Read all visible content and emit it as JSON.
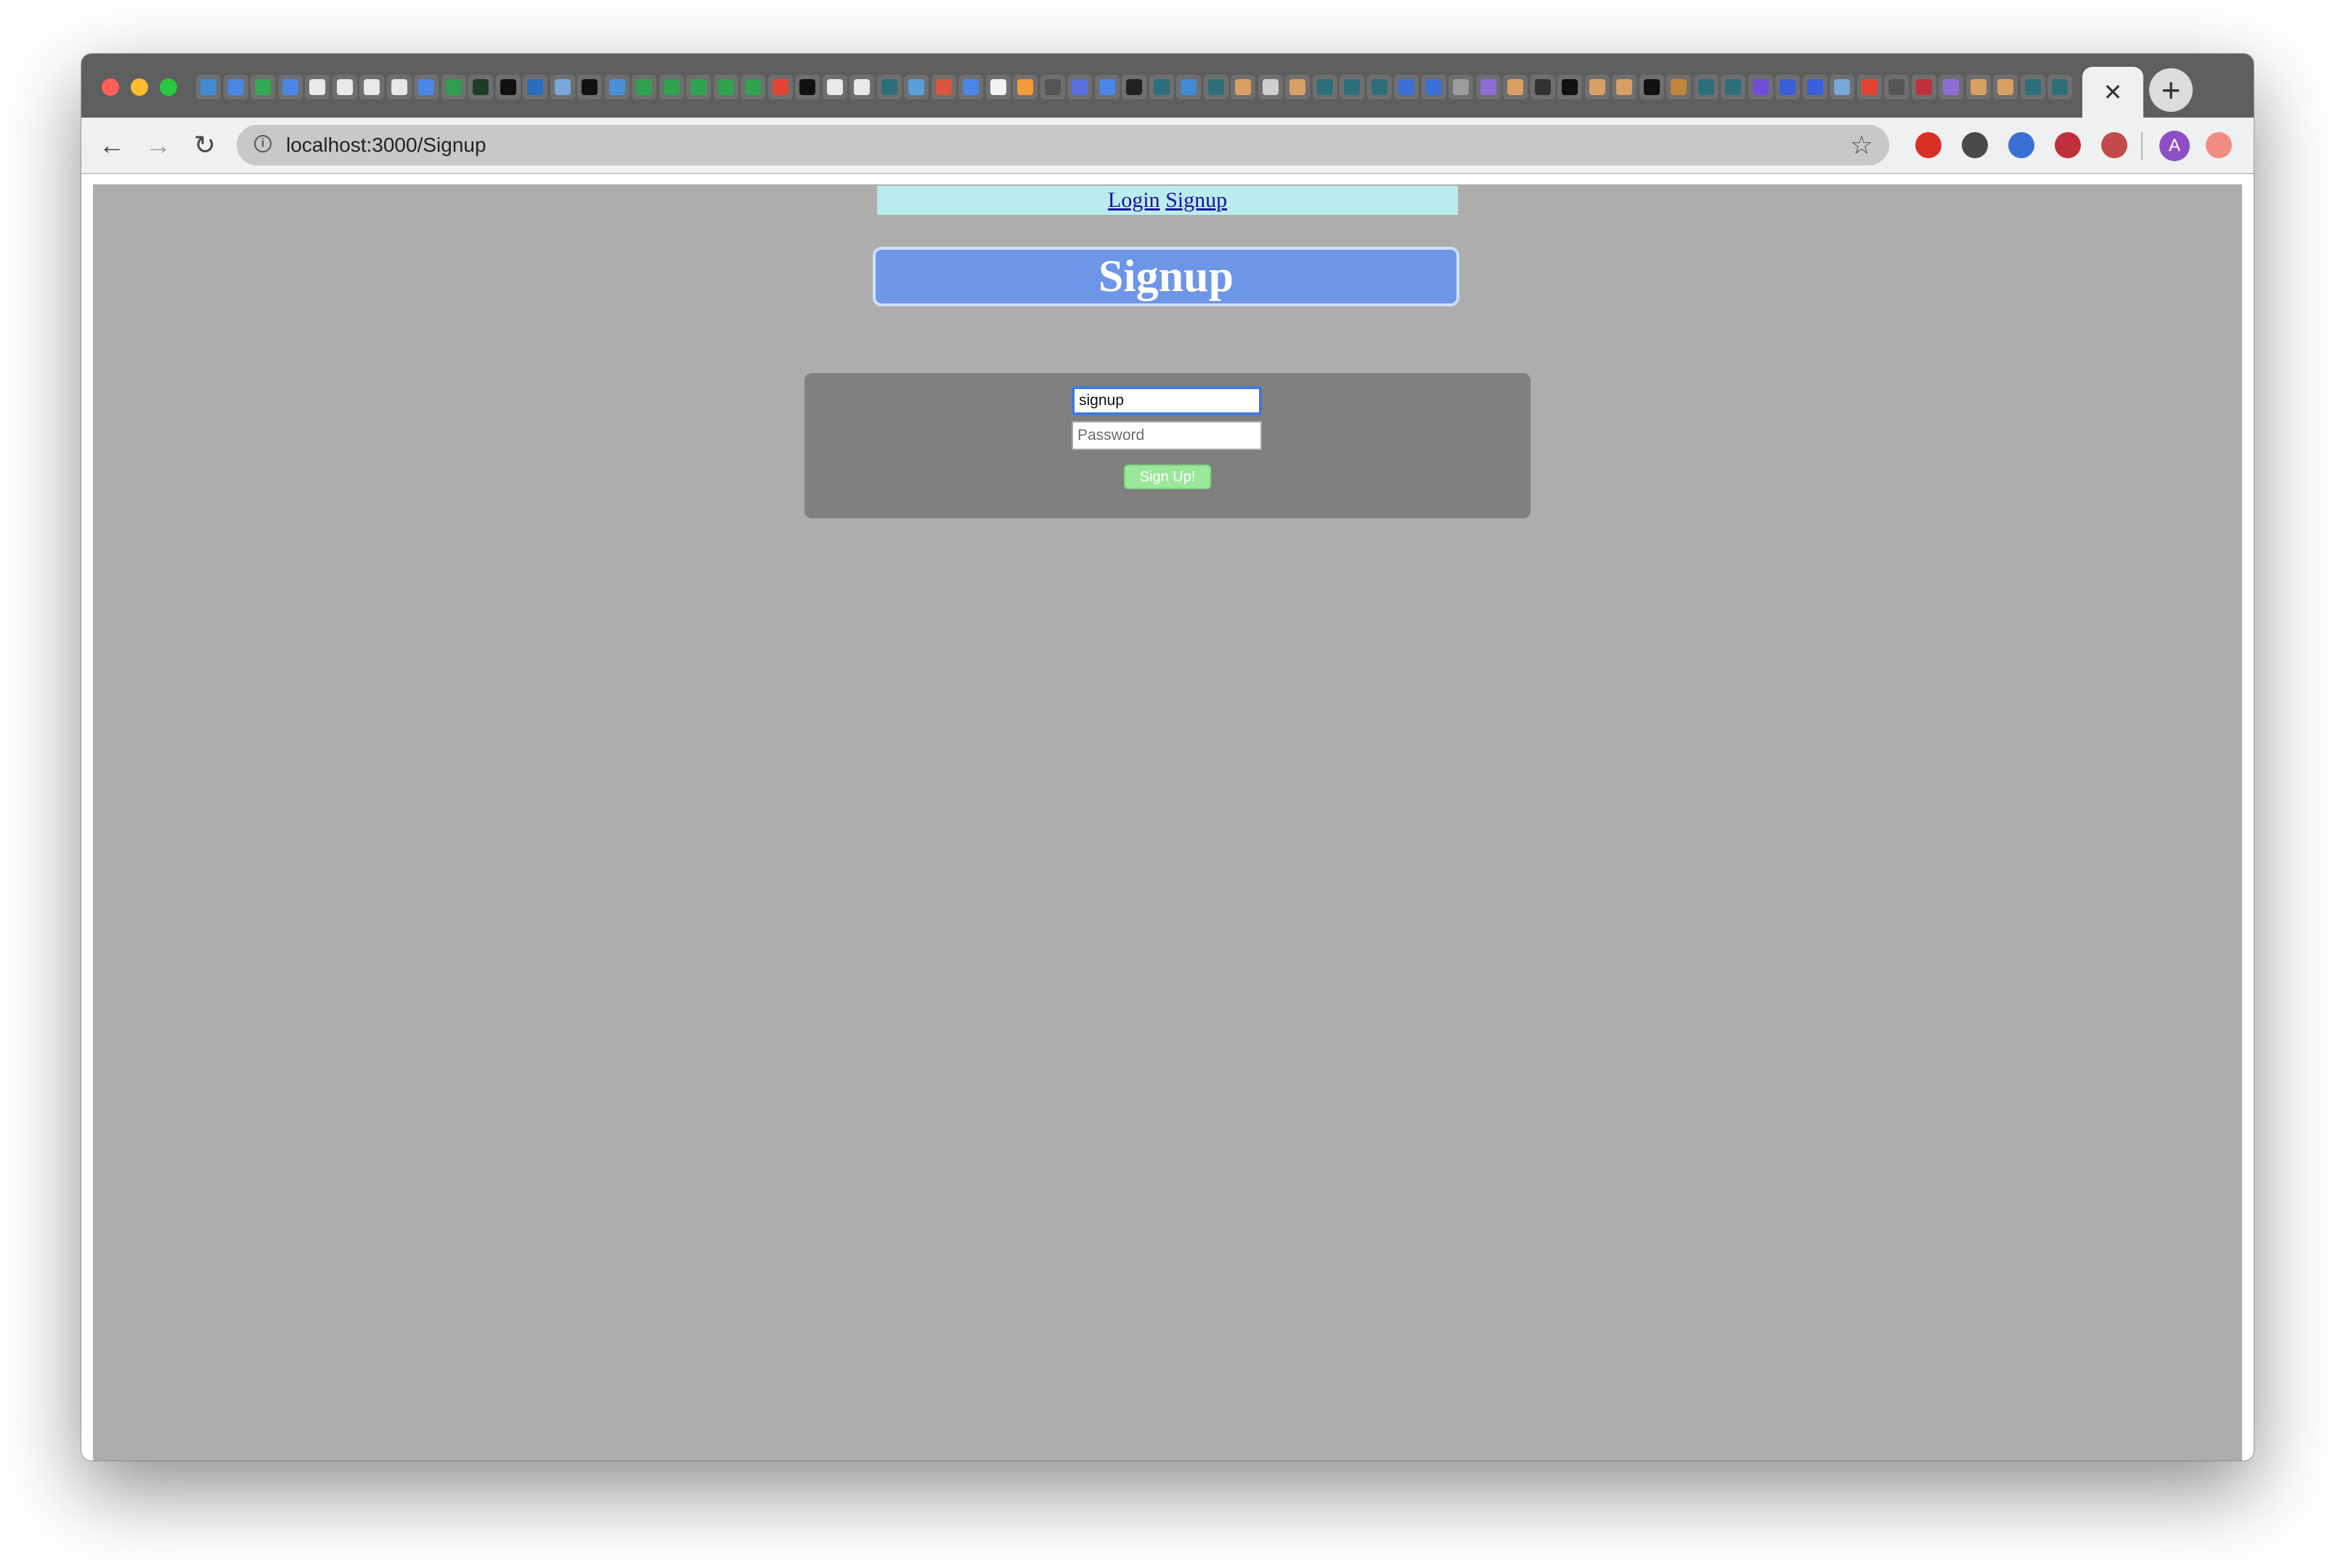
{
  "browser": {
    "address_bar_url": "localhost:3000/Signup",
    "tab_close_symbol": "✕",
    "new_tab_symbol": "+",
    "back_symbol": "←",
    "forward_symbol": "→",
    "reload_symbol": "↻",
    "star_symbol": "☆",
    "info_symbol": "i",
    "profile_initial": "A",
    "pinned_tab_favicon_colors": [
      "#3f8bd6",
      "#4a86e8",
      "#34a853",
      "#4a86e8",
      "#e8e8e8",
      "#e8e8e8",
      "#e8e8e8",
      "#e8e8e8",
      "#4a86e8",
      "#2e9e4f",
      "#1f3b2a",
      "#111111",
      "#2a6ebb",
      "#7aa7d9",
      "#111111",
      "#4a90d9",
      "#2fa34f",
      "#2fa34f",
      "#2fa34f",
      "#2fa34f",
      "#2fa34f",
      "#e24333",
      "#111111",
      "#e8e8e8",
      "#e8e8e8",
      "#2c6f7a",
      "#5aa0d8",
      "#d9553b",
      "#4a86e8",
      "#f2f2f2",
      "#f29b38",
      "#555555",
      "#5b6fe0",
      "#4a86e8",
      "#222222",
      "#2c6f7a",
      "#3f8bd6",
      "#2c6f7a",
      "#d9a066",
      "#cfcfcf",
      "#d9a066",
      "#2c6f7a",
      "#2c6f7a",
      "#2c6f7a",
      "#3a6fd8",
      "#3a6fd8",
      "#9c9c9c",
      "#8a6fd8",
      "#d9a066",
      "#333333",
      "#111111",
      "#d9a066",
      "#d9a066",
      "#111111",
      "#c0863a",
      "#2c6f7a",
      "#2c6f7a",
      "#6f4fd8",
      "#3a5fd8",
      "#3a5fd8",
      "#7aa7d9",
      "#e24333",
      "#555555",
      "#c0303a",
      "#8a6fd8",
      "#d9a066",
      "#d9a066",
      "#2c6f7a",
      "#2c6f7a"
    ],
    "extension_icon_colors": [
      "#d93025",
      "#4a4a4a",
      "#3a6fd8",
      "#c0303a",
      "#c24a4a",
      "#f28b82"
    ]
  },
  "page": {
    "nav": {
      "login_label": "Login",
      "signup_label": "Signup"
    },
    "title": "Signup",
    "form": {
      "username_value": "signup",
      "password_placeholder": "Password",
      "submit_label": "Sign Up!"
    }
  },
  "colors": {
    "page_background": "#adadad",
    "nav_background": "#bbeced",
    "heading_background": "#6e96e6",
    "form_background": "#808080",
    "submit_background": "#9be89b",
    "focus_ring": "#3d7bde"
  }
}
